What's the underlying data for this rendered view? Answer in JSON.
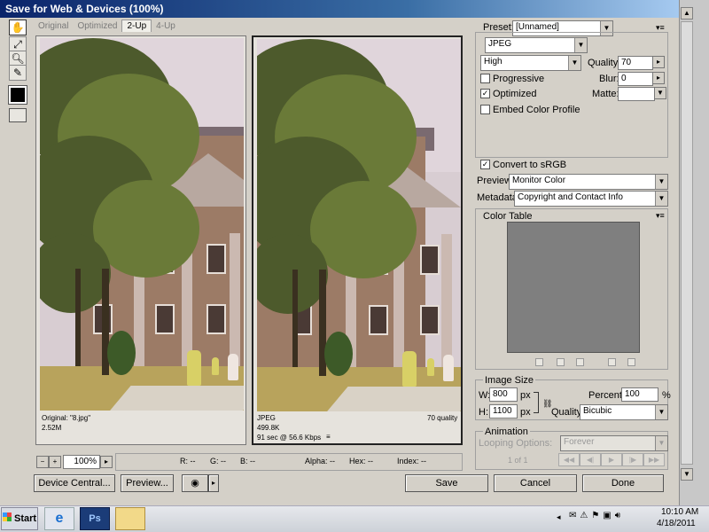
{
  "window": {
    "title": "Save for Web & Devices (100%)"
  },
  "tabs": [
    "Original",
    "Optimized",
    "2-Up",
    "4-Up"
  ],
  "active_tab": "2-Up",
  "left_pane": {
    "line1": "Original: \"8.jpg\"",
    "line2": "2.52M"
  },
  "right_pane": {
    "line1": "JPEG",
    "line2": "499.8K",
    "line3": "91 sec @ 56.6 Kbps",
    "quality": "70 quality",
    "menu_glyph": "≡"
  },
  "status": {
    "zoom": "100%",
    "zoom_minus": "−",
    "zoom_plus": "+",
    "r": "R: --",
    "g": "G: --",
    "b": "B: --",
    "alpha": "Alpha: --",
    "hex": "Hex: --",
    "index": "Index: --"
  },
  "bottom_buttons": {
    "device_central": "Device Central...",
    "preview": "Preview...",
    "save": "Save",
    "cancel": "Cancel",
    "done": "Done"
  },
  "settings": {
    "preset_label": "Preset:",
    "preset_value": "[Unnamed]",
    "format": "JPEG",
    "quality_level": "High",
    "quality_label": "Quality:",
    "quality_value": "70",
    "progressive_label": "Progressive",
    "progressive_checked": "",
    "blur_label": "Blur:",
    "blur_value": "0",
    "optimized_label": "Optimized",
    "optimized_checked": "✓",
    "matte_label": "Matte:",
    "embed_label": "Embed Color Profile",
    "embed_checked": "",
    "convert_label": "Convert to sRGB",
    "convert_checked": "✓",
    "preview_label": "Preview:",
    "preview_value": "Monitor Color",
    "metadata_label": "Metadata:",
    "metadata_value": "Copyright and Contact Info"
  },
  "color_table": {
    "title": "Color Table"
  },
  "image_size": {
    "title": "Image Size",
    "w_label": "W:",
    "w_value": "800",
    "w_unit": "px",
    "h_label": "H:",
    "h_value": "1100",
    "h_unit": "px",
    "percent_label": "Percent:",
    "percent_value": "100",
    "percent_unit": "%",
    "quality_label": "Quality:",
    "quality_value": "Bicubic"
  },
  "animation": {
    "title": "Animation",
    "looping_label": "Looping Options:",
    "looping_value": "Forever",
    "frame_counter": "1 of 1"
  },
  "taskbar": {
    "start_label": "Start",
    "ps_label": "Ps",
    "time": "10:10 AM",
    "date": "4/18/2011"
  },
  "colors": {
    "accent": "#0a246a",
    "panel": "#d4d0c8",
    "color_table_bg": "#7f7f7f"
  },
  "icons": [
    "hand-icon",
    "slice-select-icon",
    "zoom-icon",
    "eyedropper-icon",
    "ie-icon",
    "photoshop-icon",
    "folder-icon"
  ]
}
